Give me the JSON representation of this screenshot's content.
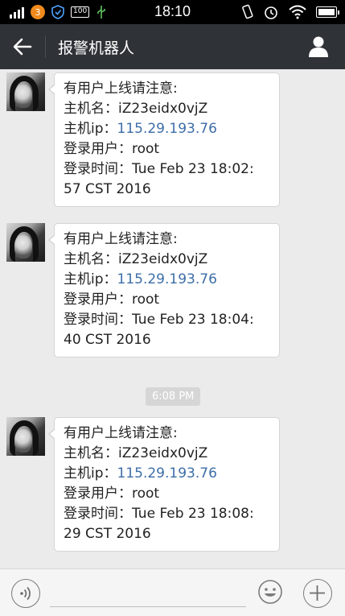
{
  "status_bar": {
    "time": "18:10",
    "notification_count": "3",
    "battery_label": "100"
  },
  "nav": {
    "title": "报警机器人"
  },
  "messages": [
    {
      "lines": [
        "有用户上线请注意:",
        "主机名：iZ23eidx0vjZ"
      ],
      "ip_prefix": "主机ip：",
      "ip": "115.29.193.76",
      "user_line": "登录用户：root",
      "time_line": "登录时间：Tue Feb 23 18:02:\n57 CST 2016"
    },
    {
      "lines": [
        "有用户上线请注意:",
        "主机名：iZ23eidx0vjZ"
      ],
      "ip_prefix": "主机ip：",
      "ip": "115.29.193.76",
      "user_line": "登录用户：root",
      "time_line": "登录时间：Tue Feb 23 18:04:\n40 CST 2016"
    },
    {
      "lines": [
        "有用户上线请注意:",
        "主机名：iZ23eidx0vjZ"
      ],
      "ip_prefix": "主机ip：",
      "ip": "115.29.193.76",
      "user_line": "登录用户：root",
      "time_line": "登录时间：Tue Feb 23 18:08:\n29 CST 2016"
    }
  ],
  "time_separator": "6:08 PM",
  "colors": {
    "nav_bg": "#2f3236",
    "chat_bg": "#ebebeb",
    "link": "#3d6ea8"
  },
  "icons": {
    "back": "back-arrow-icon",
    "profile": "user-profile-icon",
    "voice": "voice-icon",
    "emoji": "emoji-icon",
    "plus": "plus-icon"
  }
}
